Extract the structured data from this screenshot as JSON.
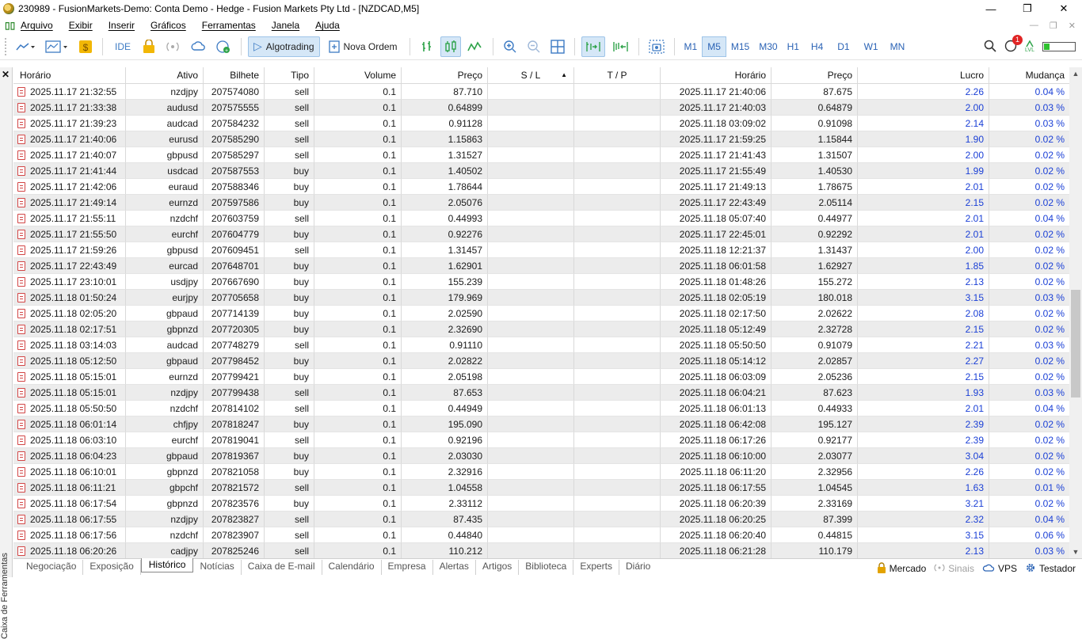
{
  "window": {
    "title": "230989 - FusionMarkets-Demo: Conta Demo - Hedge - Fusion Markets Pty Ltd - [NZDCAD,M5]",
    "minimize": "—",
    "restore": "❐",
    "close": "✕"
  },
  "menu": {
    "items": [
      "Arquivo",
      "Exibir",
      "Inserir",
      "Gráficos",
      "Ferramentas",
      "Janela",
      "Ajuda"
    ],
    "mdi": [
      "—",
      "❐",
      "✕"
    ]
  },
  "toolbar": {
    "ide_label": "IDE",
    "algotrading_label": "Algotrading",
    "nova_ordem_label": "Nova Ordem",
    "timeframes": [
      "M1",
      "M5",
      "M15",
      "M30",
      "H1",
      "H4",
      "D1",
      "W1",
      "MN"
    ],
    "active_timeframe": "M5",
    "notification_count": "1",
    "level_label": "LVL",
    "level_fraction": 0.22
  },
  "sidebar": {
    "close": "✕",
    "label": "Caixa de Ferramentas"
  },
  "grid": {
    "headers": [
      "Horário",
      "Ativo",
      "Bilhete",
      "Tipo",
      "Volume",
      "Preço",
      "S / L",
      "T / P",
      "Horário",
      "Preço",
      "Lucro",
      "Mudança"
    ],
    "sort_indicator": "▲",
    "rows": [
      [
        "2025.11.17 21:32:55",
        "nzdjpy",
        "207574080",
        "sell",
        "0.1",
        "87.710",
        "",
        "",
        "2025.11.17 21:40:06",
        "87.675",
        "2.26",
        "0.04 %"
      ],
      [
        "2025.11.17 21:33:38",
        "audusd",
        "207575555",
        "sell",
        "0.1",
        "0.64899",
        "",
        "",
        "2025.11.17 21:40:03",
        "0.64879",
        "2.00",
        "0.03 %"
      ],
      [
        "2025.11.17 21:39:23",
        "audcad",
        "207584232",
        "sell",
        "0.1",
        "0.91128",
        "",
        "",
        "2025.11.18 03:09:02",
        "0.91098",
        "2.14",
        "0.03 %"
      ],
      [
        "2025.11.17 21:40:06",
        "eurusd",
        "207585290",
        "sell",
        "0.1",
        "1.15863",
        "",
        "",
        "2025.11.17 21:59:25",
        "1.15844",
        "1.90",
        "0.02 %"
      ],
      [
        "2025.11.17 21:40:07",
        "gbpusd",
        "207585297",
        "sell",
        "0.1",
        "1.31527",
        "",
        "",
        "2025.11.17 21:41:43",
        "1.31507",
        "2.00",
        "0.02 %"
      ],
      [
        "2025.11.17 21:41:44",
        "usdcad",
        "207587553",
        "buy",
        "0.1",
        "1.40502",
        "",
        "",
        "2025.11.17 21:55:49",
        "1.40530",
        "1.99",
        "0.02 %"
      ],
      [
        "2025.11.17 21:42:06",
        "euraud",
        "207588346",
        "buy",
        "0.1",
        "1.78644",
        "",
        "",
        "2025.11.17 21:49:13",
        "1.78675",
        "2.01",
        "0.02 %"
      ],
      [
        "2025.11.17 21:49:14",
        "eurnzd",
        "207597586",
        "buy",
        "0.1",
        "2.05076",
        "",
        "",
        "2025.11.17 22:43:49",
        "2.05114",
        "2.15",
        "0.02 %"
      ],
      [
        "2025.11.17 21:55:11",
        "nzdchf",
        "207603759",
        "sell",
        "0.1",
        "0.44993",
        "",
        "",
        "2025.11.18 05:07:40",
        "0.44977",
        "2.01",
        "0.04 %"
      ],
      [
        "2025.11.17 21:55:50",
        "eurchf",
        "207604779",
        "buy",
        "0.1",
        "0.92276",
        "",
        "",
        "2025.11.17 22:45:01",
        "0.92292",
        "2.01",
        "0.02 %"
      ],
      [
        "2025.11.17 21:59:26",
        "gbpusd",
        "207609451",
        "sell",
        "0.1",
        "1.31457",
        "",
        "",
        "2025.11.18 12:21:37",
        "1.31437",
        "2.00",
        "0.02 %"
      ],
      [
        "2025.11.17 22:43:49",
        "eurcad",
        "207648701",
        "buy",
        "0.1",
        "1.62901",
        "",
        "",
        "2025.11.18 06:01:58",
        "1.62927",
        "1.85",
        "0.02 %"
      ],
      [
        "2025.11.17 23:10:01",
        "usdjpy",
        "207667690",
        "buy",
        "0.1",
        "155.239",
        "",
        "",
        "2025.11.18 01:48:26",
        "155.272",
        "2.13",
        "0.02 %"
      ],
      [
        "2025.11.18 01:50:24",
        "eurjpy",
        "207705658",
        "buy",
        "0.1",
        "179.969",
        "",
        "",
        "2025.11.18 02:05:19",
        "180.018",
        "3.15",
        "0.03 %"
      ],
      [
        "2025.11.18 02:05:20",
        "gbpaud",
        "207714139",
        "buy",
        "0.1",
        "2.02590",
        "",
        "",
        "2025.11.18 02:17:50",
        "2.02622",
        "2.08",
        "0.02 %"
      ],
      [
        "2025.11.18 02:17:51",
        "gbpnzd",
        "207720305",
        "buy",
        "0.1",
        "2.32690",
        "",
        "",
        "2025.11.18 05:12:49",
        "2.32728",
        "2.15",
        "0.02 %"
      ],
      [
        "2025.11.18 03:14:03",
        "audcad",
        "207748279",
        "sell",
        "0.1",
        "0.91110",
        "",
        "",
        "2025.11.18 05:50:50",
        "0.91079",
        "2.21",
        "0.03 %"
      ],
      [
        "2025.11.18 05:12:50",
        "gbpaud",
        "207798452",
        "buy",
        "0.1",
        "2.02822",
        "",
        "",
        "2025.11.18 05:14:12",
        "2.02857",
        "2.27",
        "0.02 %"
      ],
      [
        "2025.11.18 05:15:01",
        "eurnzd",
        "207799421",
        "buy",
        "0.1",
        "2.05198",
        "",
        "",
        "2025.11.18 06:03:09",
        "2.05236",
        "2.15",
        "0.02 %"
      ],
      [
        "2025.11.18 05:15:01",
        "nzdjpy",
        "207799438",
        "sell",
        "0.1",
        "87.653",
        "",
        "",
        "2025.11.18 06:04:21",
        "87.623",
        "1.93",
        "0.03 %"
      ],
      [
        "2025.11.18 05:50:50",
        "nzdchf",
        "207814102",
        "sell",
        "0.1",
        "0.44949",
        "",
        "",
        "2025.11.18 06:01:13",
        "0.44933",
        "2.01",
        "0.04 %"
      ],
      [
        "2025.11.18 06:01:14",
        "chfjpy",
        "207818247",
        "buy",
        "0.1",
        "195.090",
        "",
        "",
        "2025.11.18 06:42:08",
        "195.127",
        "2.39",
        "0.02 %"
      ],
      [
        "2025.11.18 06:03:10",
        "eurchf",
        "207819041",
        "sell",
        "0.1",
        "0.92196",
        "",
        "",
        "2025.11.18 06:17:26",
        "0.92177",
        "2.39",
        "0.02 %"
      ],
      [
        "2025.11.18 06:04:23",
        "gbpaud",
        "207819367",
        "buy",
        "0.1",
        "2.03030",
        "",
        "",
        "2025.11.18 06:10:00",
        "2.03077",
        "3.04",
        "0.02 %"
      ],
      [
        "2025.11.18 06:10:01",
        "gbpnzd",
        "207821058",
        "buy",
        "0.1",
        "2.32916",
        "",
        "",
        "2025.11.18 06:11:20",
        "2.32956",
        "2.26",
        "0.02 %"
      ],
      [
        "2025.11.18 06:11:21",
        "gbpchf",
        "207821572",
        "sell",
        "0.1",
        "1.04558",
        "",
        "",
        "2025.11.18 06:17:55",
        "1.04545",
        "1.63",
        "0.01 %"
      ],
      [
        "2025.11.18 06:17:54",
        "gbpnzd",
        "207823576",
        "buy",
        "0.1",
        "2.33112",
        "",
        "",
        "2025.11.18 06:20:39",
        "2.33169",
        "3.21",
        "0.02 %"
      ],
      [
        "2025.11.18 06:17:55",
        "nzdjpy",
        "207823827",
        "sell",
        "0.1",
        "87.435",
        "",
        "",
        "2025.11.18 06:20:25",
        "87.399",
        "2.32",
        "0.04 %"
      ],
      [
        "2025.11.18 06:17:56",
        "nzdchf",
        "207823907",
        "sell",
        "0.1",
        "0.44840",
        "",
        "",
        "2025.11.18 06:20:40",
        "0.44815",
        "3.15",
        "0.06 %"
      ],
      [
        "2025.11.18 06:20:26",
        "cadjpy",
        "207825246",
        "sell",
        "0.1",
        "110.212",
        "",
        "",
        "2025.11.18 06:21:28",
        "110.179",
        "2.13",
        "0.03 %"
      ]
    ]
  },
  "tabs": {
    "items": [
      "Negociação",
      "Exposição",
      "Histórico",
      "Notícias",
      "Caixa de E-mail",
      "Calendário",
      "Empresa",
      "Alertas",
      "Artigos",
      "Biblioteca",
      "Experts",
      "Diário"
    ],
    "active": "Histórico"
  },
  "status": {
    "mercado": "Mercado",
    "sinais": "Sinais",
    "vps": "VPS",
    "testador": "Testador"
  },
  "colors": {
    "profit_text": "#1a3fd6",
    "active_bg": "#d5e7f7",
    "row_alt": "#ececec"
  }
}
